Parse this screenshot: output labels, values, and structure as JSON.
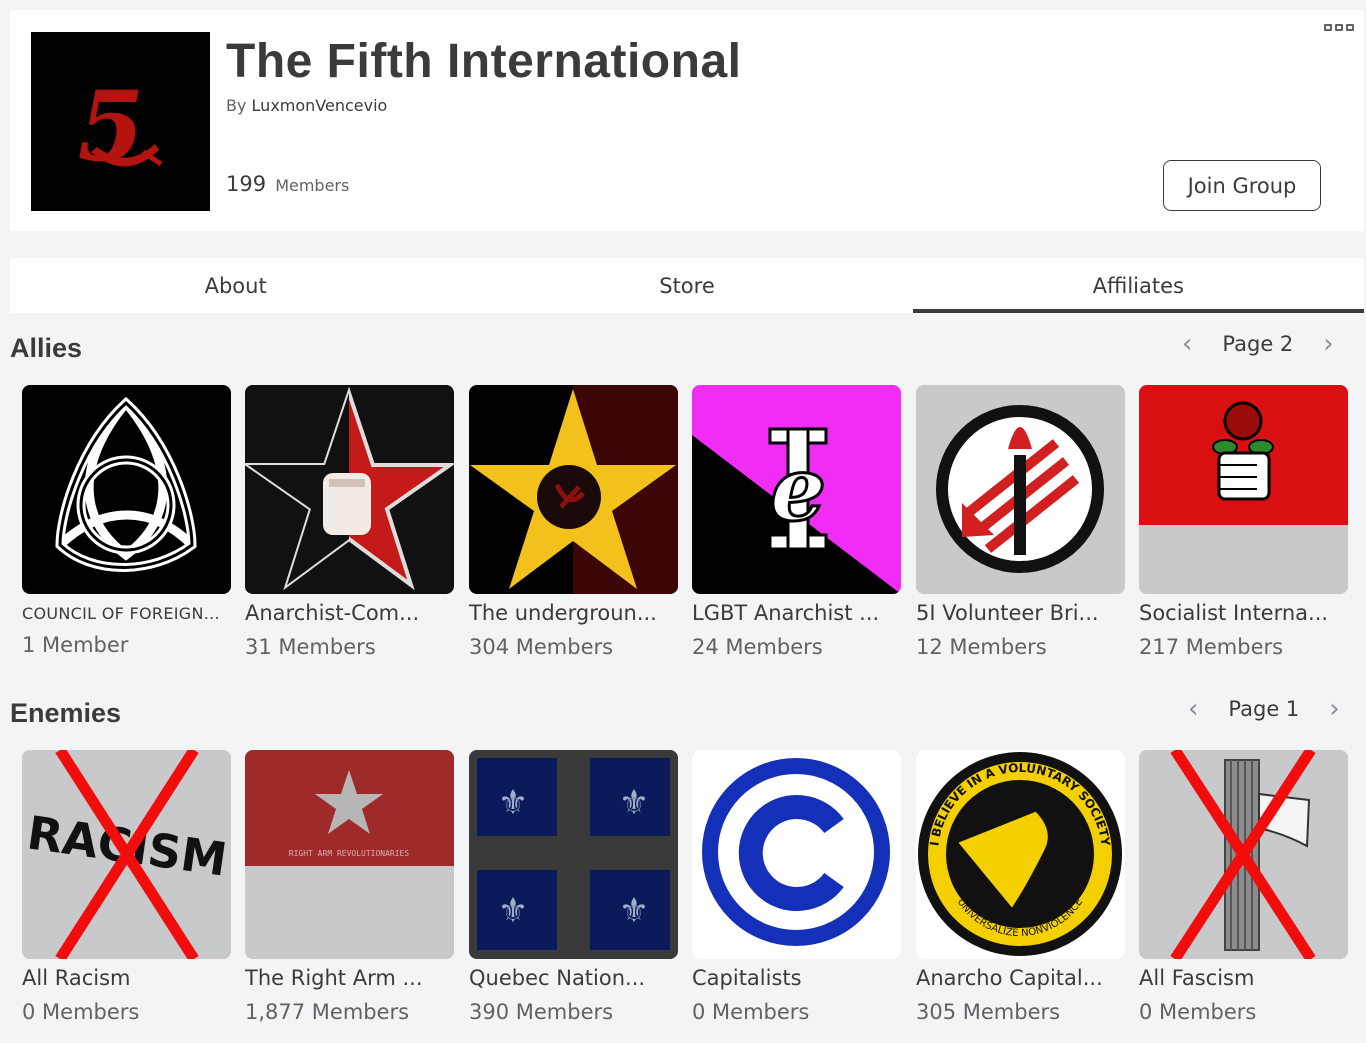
{
  "group": {
    "title": "The Fifth International",
    "by_label": "By",
    "owner": "LuxmonVencevio",
    "member_count": "199",
    "member_label": "Members",
    "join_label": "Join Group",
    "emblem_text": "5"
  },
  "tabs": [
    {
      "label": "About",
      "active": false
    },
    {
      "label": "Store",
      "active": false
    },
    {
      "label": "Affiliates",
      "active": true
    }
  ],
  "allies": {
    "title": "Allies",
    "page_label": "Page 2",
    "items": [
      {
        "name": "COUNCIL OF FOREIGN...",
        "members": "1 Member",
        "icon": "triquetra-icon"
      },
      {
        "name": "Anarchist-Com...",
        "members": "31 Members",
        "icon": "anarcho-communist-star-icon"
      },
      {
        "name": "The undergroun...",
        "members": "304 Members",
        "icon": "gold-star-hammer-sickle-icon"
      },
      {
        "name": "LGBT Anarchist ...",
        "members": "24 Members",
        "icon": "pink-black-flag-icon"
      },
      {
        "name": "5I Volunteer Bri...",
        "members": "12 Members",
        "icon": "antifa-torch-icon"
      },
      {
        "name": "Socialist Interna...",
        "members": "217 Members",
        "icon": "fist-and-rose-icon"
      }
    ]
  },
  "enemies": {
    "title": "Enemies",
    "page_label": "Page 1",
    "items": [
      {
        "name": "All Racism",
        "members": "0 Members",
        "icon": "crossed-racism-icon",
        "image_text": "RACISM"
      },
      {
        "name": "The Right Arm ...",
        "members": "1,877 Members",
        "icon": "red-star-banner-icon",
        "image_text": "RIGHT ARM REVOLUTIONARIES"
      },
      {
        "name": "Quebec Nation...",
        "members": "390 Members",
        "icon": "quebec-flag-icon"
      },
      {
        "name": "Capitalists",
        "members": "0 Members",
        "icon": "copyright-icon"
      },
      {
        "name": "Anarcho Capital...",
        "members": "305 Members",
        "icon": "voluntary-society-icon",
        "image_text_top": "I BELIEVE IN A VOLUNTARY SOCIETY",
        "image_text_bottom": "UNIVERSALIZE NONVIOLENCE"
      },
      {
        "name": "All Fascism",
        "members": "0 Members",
        "icon": "crossed-fasces-icon"
      }
    ]
  }
}
